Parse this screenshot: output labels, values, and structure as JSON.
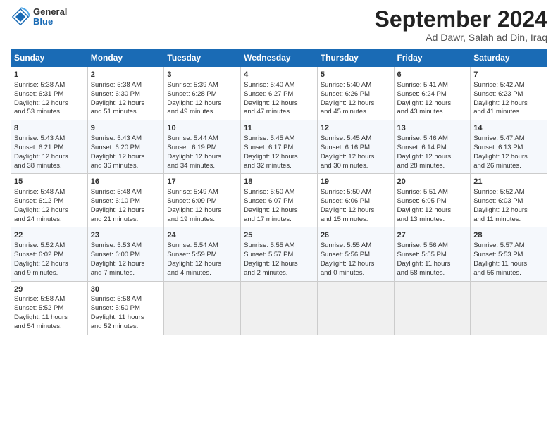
{
  "header": {
    "logo_general": "General",
    "logo_blue": "Blue",
    "month_title": "September 2024",
    "subtitle": "Ad Dawr, Salah ad Din, Iraq"
  },
  "columns": [
    "Sunday",
    "Monday",
    "Tuesday",
    "Wednesday",
    "Thursday",
    "Friday",
    "Saturday"
  ],
  "rows": [
    [
      {
        "day": "1",
        "lines": [
          "Sunrise: 5:38 AM",
          "Sunset: 6:31 PM",
          "Daylight: 12 hours",
          "and 53 minutes."
        ]
      },
      {
        "day": "2",
        "lines": [
          "Sunrise: 5:38 AM",
          "Sunset: 6:30 PM",
          "Daylight: 12 hours",
          "and 51 minutes."
        ]
      },
      {
        "day": "3",
        "lines": [
          "Sunrise: 5:39 AM",
          "Sunset: 6:28 PM",
          "Daylight: 12 hours",
          "and 49 minutes."
        ]
      },
      {
        "day": "4",
        "lines": [
          "Sunrise: 5:40 AM",
          "Sunset: 6:27 PM",
          "Daylight: 12 hours",
          "and 47 minutes."
        ]
      },
      {
        "day": "5",
        "lines": [
          "Sunrise: 5:40 AM",
          "Sunset: 6:26 PM",
          "Daylight: 12 hours",
          "and 45 minutes."
        ]
      },
      {
        "day": "6",
        "lines": [
          "Sunrise: 5:41 AM",
          "Sunset: 6:24 PM",
          "Daylight: 12 hours",
          "and 43 minutes."
        ]
      },
      {
        "day": "7",
        "lines": [
          "Sunrise: 5:42 AM",
          "Sunset: 6:23 PM",
          "Daylight: 12 hours",
          "and 41 minutes."
        ]
      }
    ],
    [
      {
        "day": "8",
        "lines": [
          "Sunrise: 5:43 AM",
          "Sunset: 6:21 PM",
          "Daylight: 12 hours",
          "and 38 minutes."
        ]
      },
      {
        "day": "9",
        "lines": [
          "Sunrise: 5:43 AM",
          "Sunset: 6:20 PM",
          "Daylight: 12 hours",
          "and 36 minutes."
        ]
      },
      {
        "day": "10",
        "lines": [
          "Sunrise: 5:44 AM",
          "Sunset: 6:19 PM",
          "Daylight: 12 hours",
          "and 34 minutes."
        ]
      },
      {
        "day": "11",
        "lines": [
          "Sunrise: 5:45 AM",
          "Sunset: 6:17 PM",
          "Daylight: 12 hours",
          "and 32 minutes."
        ]
      },
      {
        "day": "12",
        "lines": [
          "Sunrise: 5:45 AM",
          "Sunset: 6:16 PM",
          "Daylight: 12 hours",
          "and 30 minutes."
        ]
      },
      {
        "day": "13",
        "lines": [
          "Sunrise: 5:46 AM",
          "Sunset: 6:14 PM",
          "Daylight: 12 hours",
          "and 28 minutes."
        ]
      },
      {
        "day": "14",
        "lines": [
          "Sunrise: 5:47 AM",
          "Sunset: 6:13 PM",
          "Daylight: 12 hours",
          "and 26 minutes."
        ]
      }
    ],
    [
      {
        "day": "15",
        "lines": [
          "Sunrise: 5:48 AM",
          "Sunset: 6:12 PM",
          "Daylight: 12 hours",
          "and 24 minutes."
        ]
      },
      {
        "day": "16",
        "lines": [
          "Sunrise: 5:48 AM",
          "Sunset: 6:10 PM",
          "Daylight: 12 hours",
          "and 21 minutes."
        ]
      },
      {
        "day": "17",
        "lines": [
          "Sunrise: 5:49 AM",
          "Sunset: 6:09 PM",
          "Daylight: 12 hours",
          "and 19 minutes."
        ]
      },
      {
        "day": "18",
        "lines": [
          "Sunrise: 5:50 AM",
          "Sunset: 6:07 PM",
          "Daylight: 12 hours",
          "and 17 minutes."
        ]
      },
      {
        "day": "19",
        "lines": [
          "Sunrise: 5:50 AM",
          "Sunset: 6:06 PM",
          "Daylight: 12 hours",
          "and 15 minutes."
        ]
      },
      {
        "day": "20",
        "lines": [
          "Sunrise: 5:51 AM",
          "Sunset: 6:05 PM",
          "Daylight: 12 hours",
          "and 13 minutes."
        ]
      },
      {
        "day": "21",
        "lines": [
          "Sunrise: 5:52 AM",
          "Sunset: 6:03 PM",
          "Daylight: 12 hours",
          "and 11 minutes."
        ]
      }
    ],
    [
      {
        "day": "22",
        "lines": [
          "Sunrise: 5:52 AM",
          "Sunset: 6:02 PM",
          "Daylight: 12 hours",
          "and 9 minutes."
        ]
      },
      {
        "day": "23",
        "lines": [
          "Sunrise: 5:53 AM",
          "Sunset: 6:00 PM",
          "Daylight: 12 hours",
          "and 7 minutes."
        ]
      },
      {
        "day": "24",
        "lines": [
          "Sunrise: 5:54 AM",
          "Sunset: 5:59 PM",
          "Daylight: 12 hours",
          "and 4 minutes."
        ]
      },
      {
        "day": "25",
        "lines": [
          "Sunrise: 5:55 AM",
          "Sunset: 5:57 PM",
          "Daylight: 12 hours",
          "and 2 minutes."
        ]
      },
      {
        "day": "26",
        "lines": [
          "Sunrise: 5:55 AM",
          "Sunset: 5:56 PM",
          "Daylight: 12 hours",
          "and 0 minutes."
        ]
      },
      {
        "day": "27",
        "lines": [
          "Sunrise: 5:56 AM",
          "Sunset: 5:55 PM",
          "Daylight: 11 hours",
          "and 58 minutes."
        ]
      },
      {
        "day": "28",
        "lines": [
          "Sunrise: 5:57 AM",
          "Sunset: 5:53 PM",
          "Daylight: 11 hours",
          "and 56 minutes."
        ]
      }
    ],
    [
      {
        "day": "29",
        "lines": [
          "Sunrise: 5:58 AM",
          "Sunset: 5:52 PM",
          "Daylight: 11 hours",
          "and 54 minutes."
        ]
      },
      {
        "day": "30",
        "lines": [
          "Sunrise: 5:58 AM",
          "Sunset: 5:50 PM",
          "Daylight: 11 hours",
          "and 52 minutes."
        ]
      },
      null,
      null,
      null,
      null,
      null
    ]
  ]
}
